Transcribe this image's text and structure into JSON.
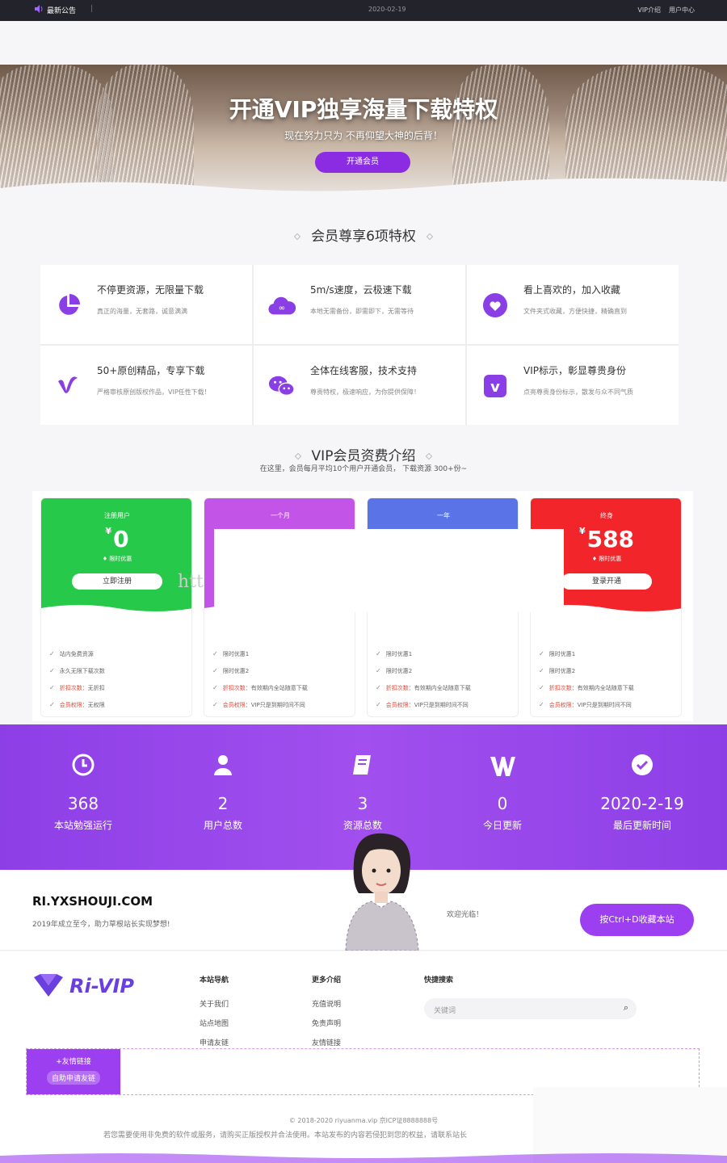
{
  "topbar": {
    "notice": "最新公告",
    "sep": "|",
    "date": "2020-02-19",
    "links": [
      "VIP介绍",
      "用户中心"
    ]
  },
  "hero": {
    "title": "开通VIP独享海量下载特权",
    "subtitle": "现在努力只为 不再仰望大神的后背！",
    "button": "开通会员"
  },
  "privileges": {
    "title": "会员尊享6项特权",
    "items": [
      {
        "title": "不停更资源，无限量下载",
        "desc": "真正的海量，无套路，诚意满满",
        "icon": "pie-chart-icon",
        "color": "#8a3fe6"
      },
      {
        "title": "5m/s速度，云极速下载",
        "desc": "本地无需备份，即需即下，无需等待",
        "icon": "cloud-icon",
        "color": "#8a3fe6"
      },
      {
        "title": "看上喜欢的，加入收藏",
        "desc": "文件夹式收藏，方便快捷，精确直到",
        "icon": "heart-icon",
        "color": "#8a3fe6"
      },
      {
        "title": "50+原创精品，专享下载",
        "desc": "严格审核原创版权作品，VIP任性下载！",
        "icon": "vimeo-icon",
        "color": "#8a3fe6"
      },
      {
        "title": "全体在线客服，技术支持",
        "desc": "尊贵特权，极速响应，为你提供保障！",
        "icon": "wechat-icon",
        "color": "#8a3fe6"
      },
      {
        "title": "VIP标示，彰显尊贵身份",
        "desc": "点亮尊贵身份标示，散发与众不同气质",
        "icon": "vip-badge-icon",
        "color": "#8a3fe6"
      }
    ]
  },
  "vip": {
    "title": "VIP会员资费介绍",
    "subtitle": "在这里，会员每月平均10个用户开通会员， 下载资源 300+份~",
    "ghost": "htt",
    "plans": [
      {
        "name": "注册用户",
        "currency": "¥",
        "price": "0",
        "tag": "限时优惠",
        "button": "立即注册",
        "color": "#27c94b",
        "features": [
          {
            "k": "",
            "v": "站内免费资源"
          },
          {
            "k": "",
            "v": "永久无限下载次数"
          },
          {
            "k": "折扣次数",
            "v": "：无折扣"
          },
          {
            "k": "会员权限",
            "v": "：无权限"
          }
        ]
      },
      {
        "name": "一个月",
        "currency": "",
        "price": "",
        "tag": "",
        "button": "",
        "color": "#c255e8",
        "features": [
          {
            "k": "",
            "v": "限时优惠1"
          },
          {
            "k": "",
            "v": "限时优惠2"
          },
          {
            "k": "折扣次数",
            "v": "：有效期内全站随意下载"
          },
          {
            "k": "会员权限",
            "v": "：VIP只是到期时间不同"
          }
        ]
      },
      {
        "name": "一年",
        "currency": "",
        "price": "",
        "tag": "",
        "button": "",
        "color": "#5a74e8",
        "features": [
          {
            "k": "",
            "v": "限时优惠1"
          },
          {
            "k": "",
            "v": "限时优惠2"
          },
          {
            "k": "折扣次数",
            "v": "：有效期内全站随意下载"
          },
          {
            "k": "会员权限",
            "v": "：VIP只是到期时间不同"
          }
        ]
      },
      {
        "name": "终身",
        "currency": "¥",
        "price": "588",
        "tag": "限时优惠",
        "button": "登录开通",
        "color": "#f2262a",
        "features": [
          {
            "k": "",
            "v": "限时优惠1"
          },
          {
            "k": "",
            "v": "限时优惠2"
          },
          {
            "k": "折扣次数",
            "v": "：有效期内全站随意下载"
          },
          {
            "k": "会员权限",
            "v": "：VIP只是到期时间不同"
          }
        ]
      }
    ]
  },
  "stats": [
    {
      "value": "368",
      "label": "本站勉强运行",
      "icon": "clock-icon"
    },
    {
      "value": "2",
      "label": "用户总数",
      "icon": "user-icon"
    },
    {
      "value": "3",
      "label": "资源总数",
      "icon": "book-icon"
    },
    {
      "value": "0",
      "label": "今日更新",
      "icon": "w-icon"
    },
    {
      "value": "2020-2-19",
      "label": "最后更新时间",
      "icon": "check-circle-icon"
    }
  ],
  "contact": {
    "site": "RI.YXSHOUJI.COM",
    "slogan": "2019年成立至今，助力草根站长实现梦想!",
    "welcome": "欢迎光临！",
    "favorite": "按Ctrl+D收藏本站"
  },
  "footer": {
    "logo": "Ri-VIP",
    "nav": {
      "title": "本站导航",
      "links": [
        "关于我们",
        "站点地图",
        "申请友链"
      ]
    },
    "more": {
      "title": "更多介绍",
      "links": [
        "充值说明",
        "免责声明",
        "友情链接"
      ]
    },
    "search": {
      "title": "快捷搜索",
      "placeholder": "关键词"
    },
    "friends": {
      "label": "+友情链接",
      "button": "自助申请友链"
    },
    "copyright": "© 2018-2020 riyuanma.vip 京ICP证8888888号",
    "disclaimer": "若您需要使用非免费的软件或服务，请购买正版授权并合法使用。本站发布的内容若侵犯到您的权益，请联系站长"
  }
}
